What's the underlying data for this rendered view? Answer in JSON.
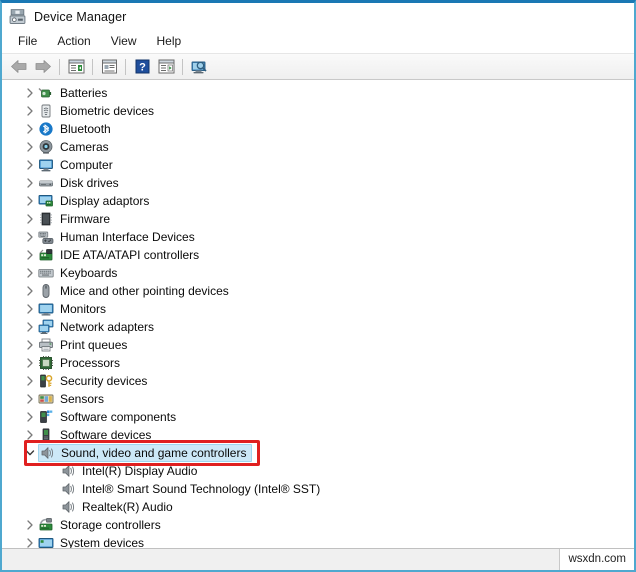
{
  "window": {
    "title": "Device Manager",
    "title_icon": "device-manager-icon",
    "border_color": "#4fa8cf",
    "accent_color": "#1a78b4"
  },
  "menubar": {
    "items": [
      {
        "label": "File",
        "name": "menu-file"
      },
      {
        "label": "Action",
        "name": "menu-action"
      },
      {
        "label": "View",
        "name": "menu-view"
      },
      {
        "label": "Help",
        "name": "menu-help"
      }
    ]
  },
  "toolbar": {
    "buttons": [
      {
        "name": "back-button",
        "icon": "back-arrow-icon",
        "tooltip": "Back"
      },
      {
        "name": "forward-button",
        "icon": "forward-arrow-icon",
        "tooltip": "Forward"
      },
      {
        "name": "show-hide-console-tree-button",
        "icon": "console-tree-icon",
        "tooltip": "Show/Hide Console Tree"
      },
      {
        "name": "properties-button",
        "icon": "properties-icon",
        "tooltip": "Properties"
      },
      {
        "name": "help-button",
        "icon": "help-question-icon",
        "tooltip": "Help"
      },
      {
        "name": "update-driver-button",
        "icon": "update-driver-icon",
        "tooltip": "Update driver"
      },
      {
        "name": "scan-hardware-changes-button",
        "icon": "scan-hardware-icon",
        "tooltip": "Scan for hardware changes"
      }
    ]
  },
  "tree": {
    "selected_index": 19,
    "selection_color": "#cce8f7",
    "items": [
      {
        "label": "Batteries",
        "depth": 0,
        "state": "collapsed",
        "icon": "batteries-icon"
      },
      {
        "label": "Biometric devices",
        "depth": 0,
        "state": "collapsed",
        "icon": "biometric-icon"
      },
      {
        "label": "Bluetooth",
        "depth": 0,
        "state": "collapsed",
        "icon": "bluetooth-icon"
      },
      {
        "label": "Cameras",
        "depth": 0,
        "state": "collapsed",
        "icon": "camera-icon"
      },
      {
        "label": "Computer",
        "depth": 0,
        "state": "collapsed",
        "icon": "computer-icon"
      },
      {
        "label": "Disk drives",
        "depth": 0,
        "state": "collapsed",
        "icon": "disk-drive-icon"
      },
      {
        "label": "Display adaptors",
        "depth": 0,
        "state": "collapsed",
        "icon": "display-adapter-icon"
      },
      {
        "label": "Firmware",
        "depth": 0,
        "state": "collapsed",
        "icon": "firmware-icon"
      },
      {
        "label": "Human Interface Devices",
        "depth": 0,
        "state": "collapsed",
        "icon": "hid-icon"
      },
      {
        "label": "IDE ATA/ATAPI controllers",
        "depth": 0,
        "state": "collapsed",
        "icon": "ide-controller-icon"
      },
      {
        "label": "Keyboards",
        "depth": 0,
        "state": "collapsed",
        "icon": "keyboard-icon"
      },
      {
        "label": "Mice and other pointing devices",
        "depth": 0,
        "state": "collapsed",
        "icon": "mouse-icon"
      },
      {
        "label": "Monitors",
        "depth": 0,
        "state": "collapsed",
        "icon": "monitor-icon"
      },
      {
        "label": "Network adapters",
        "depth": 0,
        "state": "collapsed",
        "icon": "network-adapter-icon"
      },
      {
        "label": "Print queues",
        "depth": 0,
        "state": "collapsed",
        "icon": "printer-icon"
      },
      {
        "label": "Processors",
        "depth": 0,
        "state": "collapsed",
        "icon": "processor-icon"
      },
      {
        "label": "Security devices",
        "depth": 0,
        "state": "collapsed",
        "icon": "security-device-icon"
      },
      {
        "label": "Sensors",
        "depth": 0,
        "state": "collapsed",
        "icon": "sensor-icon"
      },
      {
        "label": "Software components",
        "depth": 0,
        "state": "collapsed",
        "icon": "software-component-icon"
      },
      {
        "label": "Software devices",
        "depth": 0,
        "state": "collapsed",
        "icon": "software-device-icon"
      },
      {
        "label": "Sound, video and game controllers",
        "depth": 0,
        "state": "expanded",
        "icon": "speaker-icon",
        "selected": true
      },
      {
        "label": "Intel(R) Display Audio",
        "depth": 1,
        "state": "leaf",
        "icon": "speaker-icon"
      },
      {
        "label": "Intel® Smart Sound Technology (Intel® SST)",
        "depth": 1,
        "state": "leaf",
        "icon": "speaker-icon"
      },
      {
        "label": "Realtek(R) Audio",
        "depth": 1,
        "state": "leaf",
        "icon": "speaker-icon"
      },
      {
        "label": "Storage controllers",
        "depth": 0,
        "state": "collapsed",
        "icon": "storage-controller-icon"
      },
      {
        "label": "System devices",
        "depth": 0,
        "state": "collapsed",
        "icon": "system-device-icon"
      }
    ]
  },
  "annotation": {
    "color": "#e02020",
    "target_label": "Sound, video and game controllers"
  },
  "statusbar": {
    "watermark": "wsxdn.com"
  }
}
